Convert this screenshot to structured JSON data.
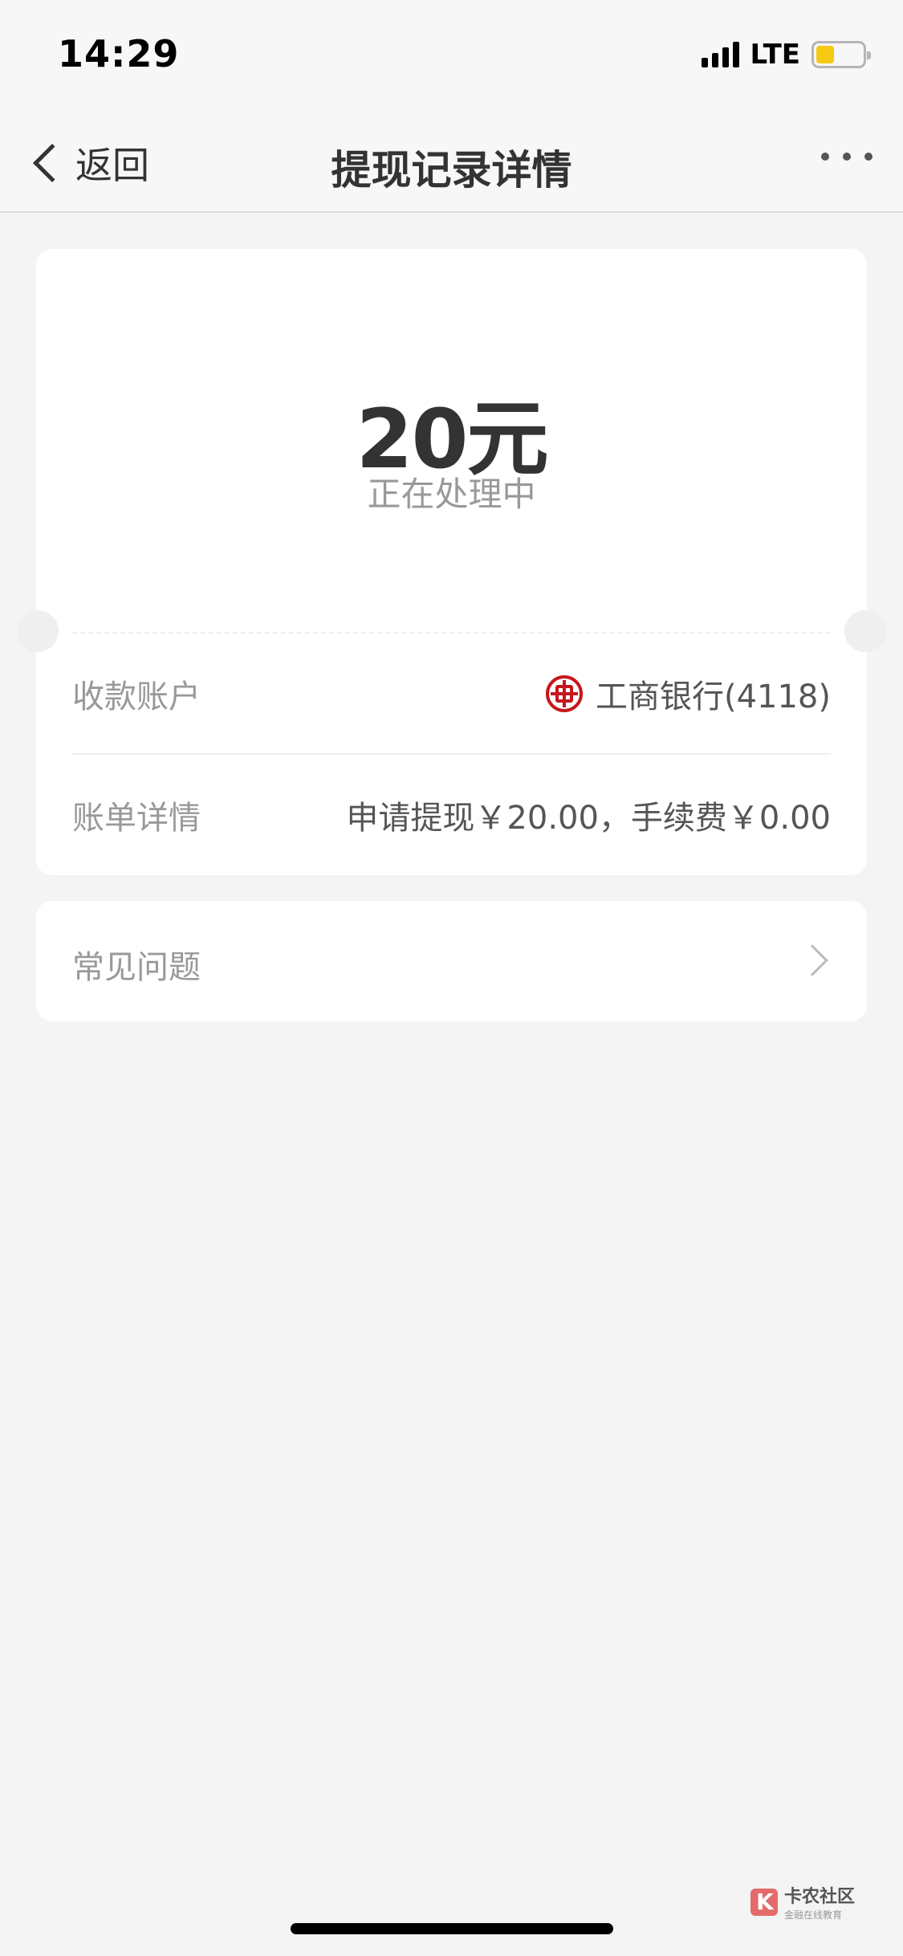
{
  "status_bar": {
    "time": "14:29",
    "network": "LTE",
    "battery_level": 0.4,
    "battery_color": "#f6c913"
  },
  "nav": {
    "back_label": "返回",
    "title": "提现记录详情",
    "more_icon": "more-dots-icon"
  },
  "summary": {
    "amount": "20元",
    "status": "正在处理中"
  },
  "details": {
    "account_label": "收款账户",
    "account_value": "工商银行(4118)",
    "bank_icon": "icbc-logo-icon",
    "bill_label": "账单详情",
    "bill_value": "申请提现￥20.00，手续费￥0.00"
  },
  "faq": {
    "label": "常见问题",
    "icon": "chevron-right-icon"
  },
  "watermark": {
    "title": "卡农社区",
    "subtitle": "金融在线教育"
  },
  "colors": {
    "background": "#f4f4f4",
    "card": "#ffffff",
    "bank_red": "#c8161d"
  }
}
